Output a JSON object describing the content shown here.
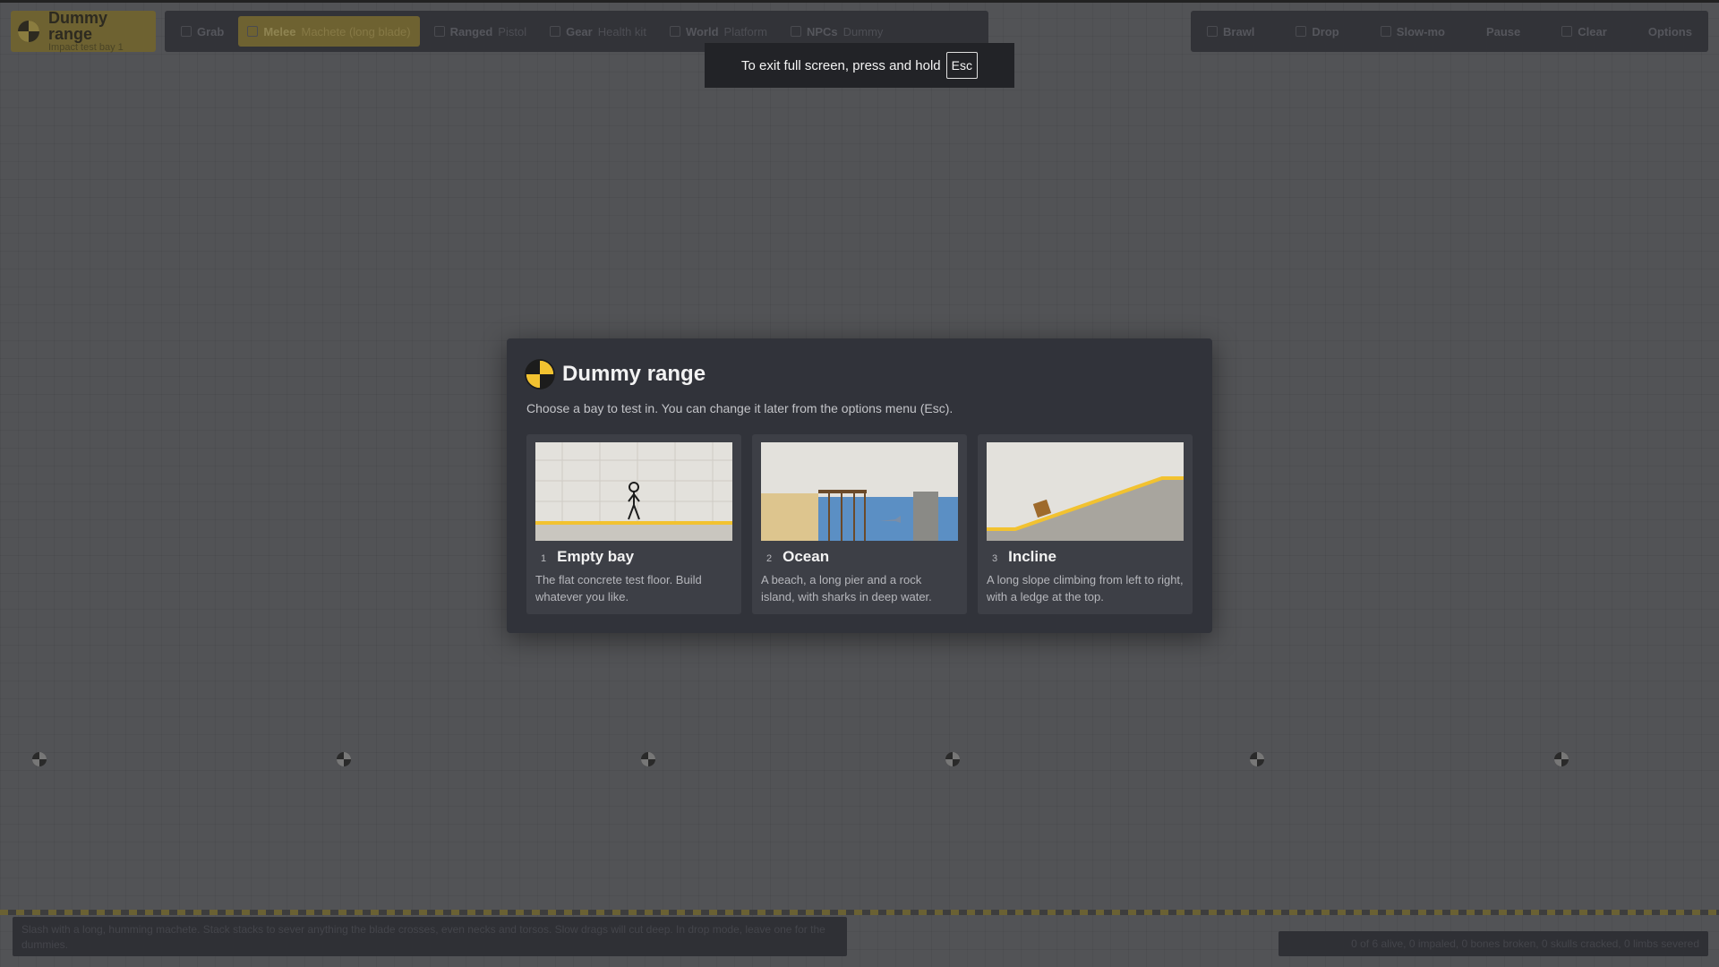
{
  "app": {
    "title": "Dummy range",
    "subtitle": "Impact test bay 1"
  },
  "toolbar_left": [
    {
      "label": "Grab",
      "value": ""
    },
    {
      "label": "Melee",
      "value": "Machete (long blade)"
    },
    {
      "label": "Ranged",
      "value": "Pistol"
    },
    {
      "label": "Gear",
      "value": "Health kit"
    },
    {
      "label": "World",
      "value": "Platform"
    },
    {
      "label": "NPCs",
      "value": "Dummy"
    }
  ],
  "toolbar_right": [
    "Brawl",
    "Drop",
    "Slow-mo",
    "Pause",
    "Clear",
    "Options"
  ],
  "fullscreen_toast": {
    "text": "To exit full screen, press and hold",
    "key": "Esc"
  },
  "modal": {
    "title": "Dummy range",
    "description": "Choose a bay to test in. You can change it later from the options menu (Esc).",
    "options": [
      {
        "num": "1",
        "name": "Empty bay",
        "desc": "The flat concrete test floor. Build whatever you like."
      },
      {
        "num": "2",
        "name": "Ocean",
        "desc": "A beach, a long pier and a rock island, with sharks in deep water."
      },
      {
        "num": "3",
        "name": "Incline",
        "desc": "A long slope climbing from left to right, with a ledge at the top."
      }
    ]
  },
  "hint": "Slash with a long, humming machete. Stack stacks to sever anything the blade crosses, even necks and torsos. Slow drags will cut deep. In drop mode, leave one for the dummies.",
  "stats": "0 of 6 alive, 0 impaled, 0 bones broken, 0 skulls cracked, 0 limbs severed",
  "colors": {
    "accent": "#f2c230",
    "modal_bg": "#31333a",
    "card_bg": "#3d3f46",
    "page_bg": "#525356"
  },
  "icons": [
    "crash-test-dummy-icon"
  ]
}
